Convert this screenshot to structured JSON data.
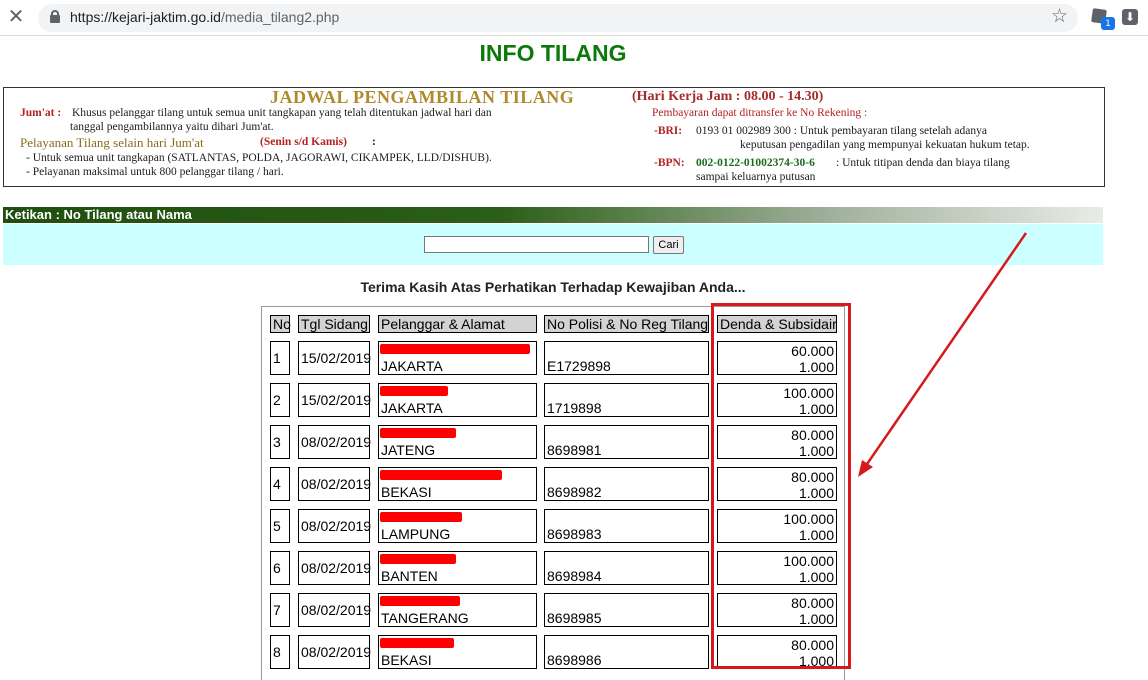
{
  "browser": {
    "url_host": "https://kejari-jaktim.go.id",
    "url_path": "/media_tilang2.php",
    "ext_badge": "1"
  },
  "page": {
    "title": "INFO TILANG",
    "thanks_text": "Terima Kasih Atas Perhatikan Terhadap Kewajiban Anda..."
  },
  "banner": {
    "title": "JADWAL PENGAMBILAN TILANG",
    "hours": "(Hari Kerja Jam : 08.00 - 14.30)",
    "jumat_label": "Jum'at :",
    "jumat_line1": "Khusus pelanggar tilang untuk semua unit tangkapan yang telah ditentukan jadwal hari dan",
    "jumat_line2": "tanggal pengambilannya yaitu dihari  Jum'at.",
    "other_label": "Pelayanan Tilang selain hari Jum'at",
    "other_days": "(Senin s/d Kamis)",
    "other_colon": ":",
    "other_line1": "- Untuk semua unit tangkapan (SATLANTAS, POLDA, JAGORAWI, CIKAMPEK, LLD/DISHUB).",
    "other_line2": "- Pelayanan maksimal untuk 800 pelanggar tilang / hari.",
    "transfer_head": "Pembayaran dapat ditransfer ke No Rekening :",
    "bri_label": "-BRI:",
    "bri_line1": "0193 01 002989 300 : Untuk pembayaran tilang setelah adanya",
    "bri_line2": "keputusan pengadilan yang mempunyai kekuatan hukum tetap.",
    "bpn_label": "-BPN:",
    "bpn_number": "002-0122-01002374-30-6",
    "bpn_line1": ": Untuk  titipan denda   dan biaya tilang",
    "bpn_line2": "sampai keluarnya putusan"
  },
  "search": {
    "label": "Ketikan : No Tilang atau Nama",
    "value": "",
    "button": "Cari"
  },
  "table": {
    "headers": [
      "No",
      "Tgl Sidang",
      "Pelanggar & Alamat",
      "No Polisi & No Reg Tilang",
      "Denda & Subsidair"
    ],
    "rows": [
      {
        "no": "1",
        "date": "15/02/2019",
        "city": "JAKARTA",
        "reg": "E1729898",
        "denda": "60.000",
        "subsidair": "1.000"
      },
      {
        "no": "2",
        "date": "15/02/2019",
        "city": "JAKARTA",
        "reg": "1719898",
        "denda": "100.000",
        "subsidair": "1.000"
      },
      {
        "no": "3",
        "date": "08/02/2019",
        "city": "JATENG",
        "reg": "8698981",
        "denda": "80.000",
        "subsidair": "1.000"
      },
      {
        "no": "4",
        "date": "08/02/2019",
        "city": "BEKASI",
        "reg": "8698982",
        "denda": "80.000",
        "subsidair": "1.000"
      },
      {
        "no": "5",
        "date": "08/02/2019",
        "city": "LAMPUNG",
        "reg": "8698983",
        "denda": "100.000",
        "subsidair": "1.000"
      },
      {
        "no": "6",
        "date": "08/02/2019",
        "city": "BANTEN",
        "reg": "8698984",
        "denda": "100.000",
        "subsidair": "1.000"
      },
      {
        "no": "7",
        "date": "08/02/2019",
        "city": "TANGERANG",
        "reg": "8698985",
        "denda": "80.000",
        "subsidair": "1.000"
      },
      {
        "no": "8",
        "date": "08/02/2019",
        "city": "BEKASI",
        "reg": "8698986",
        "denda": "80.000",
        "subsidair": "1.000"
      }
    ]
  },
  "colors": {
    "title_green": "#0b7a0b",
    "search_bg": "#ccffff",
    "redaction": "#ff0000",
    "annotation": "#d7191c"
  }
}
